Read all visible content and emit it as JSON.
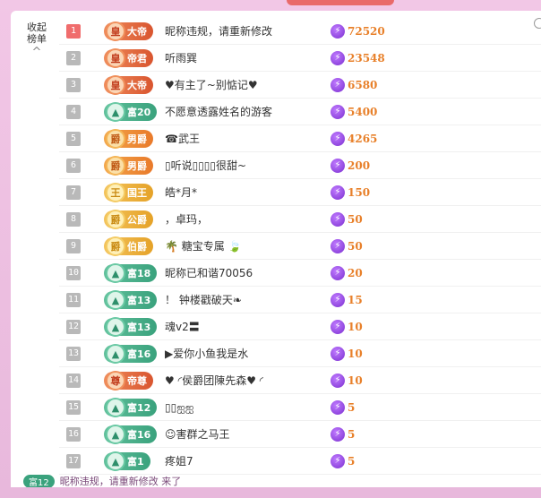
{
  "collapse": {
    "line1": "收起",
    "line2": "榜单",
    "chevron": "^"
  },
  "colors": {
    "background": "#f2c7e6",
    "score": "#e8802a",
    "rank_first": "#f06d6d",
    "rank_other": "#b9b9b9",
    "rich_badge": "#3aa27d",
    "noble_badge": "#e97a2a"
  },
  "rows": [
    {
      "rank": "1",
      "badge": "大帝",
      "badge_type": "emperor",
      "emblem": "皇",
      "name": "昵称违规，请重新修改",
      "score": "72520"
    },
    {
      "rank": "2",
      "badge": "帝君",
      "badge_type": "emperor",
      "emblem": "皇",
      "name": "听雨巽",
      "score": "23548"
    },
    {
      "rank": "3",
      "badge": "大帝",
      "badge_type": "emperor",
      "emblem": "皇",
      "name": "♥有主了~别惦记♥",
      "score": "6580"
    },
    {
      "rank": "4",
      "badge": "富20",
      "badge_type": "rich",
      "emblem": "▲",
      "name": "不愿意透露姓名的游客",
      "score": "5400"
    },
    {
      "rank": "5",
      "badge": "男爵",
      "badge_type": "noble",
      "emblem": "爵",
      "name": "☎武王",
      "score": "4265"
    },
    {
      "rank": "6",
      "badge": "男爵",
      "badge_type": "noble",
      "emblem": "爵",
      "name": "▯听说▯▯▯▯很甜~",
      "score": "200"
    },
    {
      "rank": "7",
      "badge": "国王",
      "badge_type": "gold",
      "emblem": "王",
      "name": "皓*月*",
      "score": "150"
    },
    {
      "rank": "8",
      "badge": "公爵",
      "badge_type": "gold",
      "emblem": "爵",
      "name": "，卓玛，",
      "score": "50"
    },
    {
      "rank": "9",
      "badge": "伯爵",
      "badge_type": "gold",
      "emblem": "爵",
      "name": "🌴 糖宝专属 🍃",
      "score": "50"
    },
    {
      "rank": "10",
      "badge": "富18",
      "badge_type": "rich",
      "emblem": "▲",
      "name": "昵称已和谐70056",
      "score": "20"
    },
    {
      "rank": "11",
      "badge": "富13",
      "badge_type": "rich",
      "emblem": "▲",
      "name": "！ 钟楼戳破天❧",
      "score": "15"
    },
    {
      "rank": "12",
      "badge": "富13",
      "badge_type": "rich",
      "emblem": "▲",
      "name": "魂v2〓",
      "score": "10"
    },
    {
      "rank": "13",
      "badge": "富16",
      "badge_type": "rich",
      "emblem": "▲",
      "name": "▶爱你小鱼我是水",
      "score": "10"
    },
    {
      "rank": "14",
      "badge": "帝尊",
      "badge_type": "emperor",
      "emblem": "尊",
      "name": "♥ ◜侯爵团陳先森♥ ◜",
      "score": "10"
    },
    {
      "rank": "15",
      "badge": "富12",
      "badge_type": "rich",
      "emblem": "▲",
      "name": "▯▯ஐஐ",
      "score": "5"
    },
    {
      "rank": "16",
      "badge": "富16",
      "badge_type": "rich",
      "emblem": "▲",
      "name": "☺害群之马王",
      "score": "5"
    },
    {
      "rank": "17",
      "badge": "富1",
      "badge_type": "rich",
      "emblem": "▲",
      "name": "疼姐7",
      "score": "5"
    }
  ],
  "bottom": {
    "badge": "富12",
    "text": "昵称违规，请重新修改 来了"
  }
}
